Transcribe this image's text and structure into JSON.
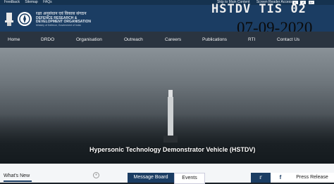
{
  "topbar": {
    "links": [
      "Feedback",
      "Sitemap",
      "FAQs"
    ],
    "skip": "Skip to Main Content",
    "reader": "Screen Reader Access",
    "font_controls": [
      "A-",
      "A",
      "A+"
    ]
  },
  "header": {
    "org_hindi": "रक्षा अनुसंधान एवं विकास संगठन",
    "org_line1": "DEFENCE RESEARCH &",
    "org_line2": "DEVELOPMENT ORGANISATION",
    "org_sub": "Ministry of Defence, Government of India",
    "ticker": "HSTDV TIS 02",
    "date": "07-09-2020"
  },
  "nav": [
    "Home",
    "DRDO",
    "Organisation",
    "Outreach",
    "Careers",
    "Publications",
    "RTI",
    "Contact Us"
  ],
  "hero": {
    "title": "Hypersonic Technology Demonstrator Vehicle (HSTDV)"
  },
  "bottom": {
    "whats_new": "What's New",
    "tabs": [
      "Message Board",
      "Events"
    ],
    "social": [
      "twitter-icon",
      "facebook-icon"
    ],
    "press": "Press Release"
  },
  "colors": {
    "navy": "#1b3d63",
    "topbar": "#15324f",
    "nav": "#2a3440"
  }
}
